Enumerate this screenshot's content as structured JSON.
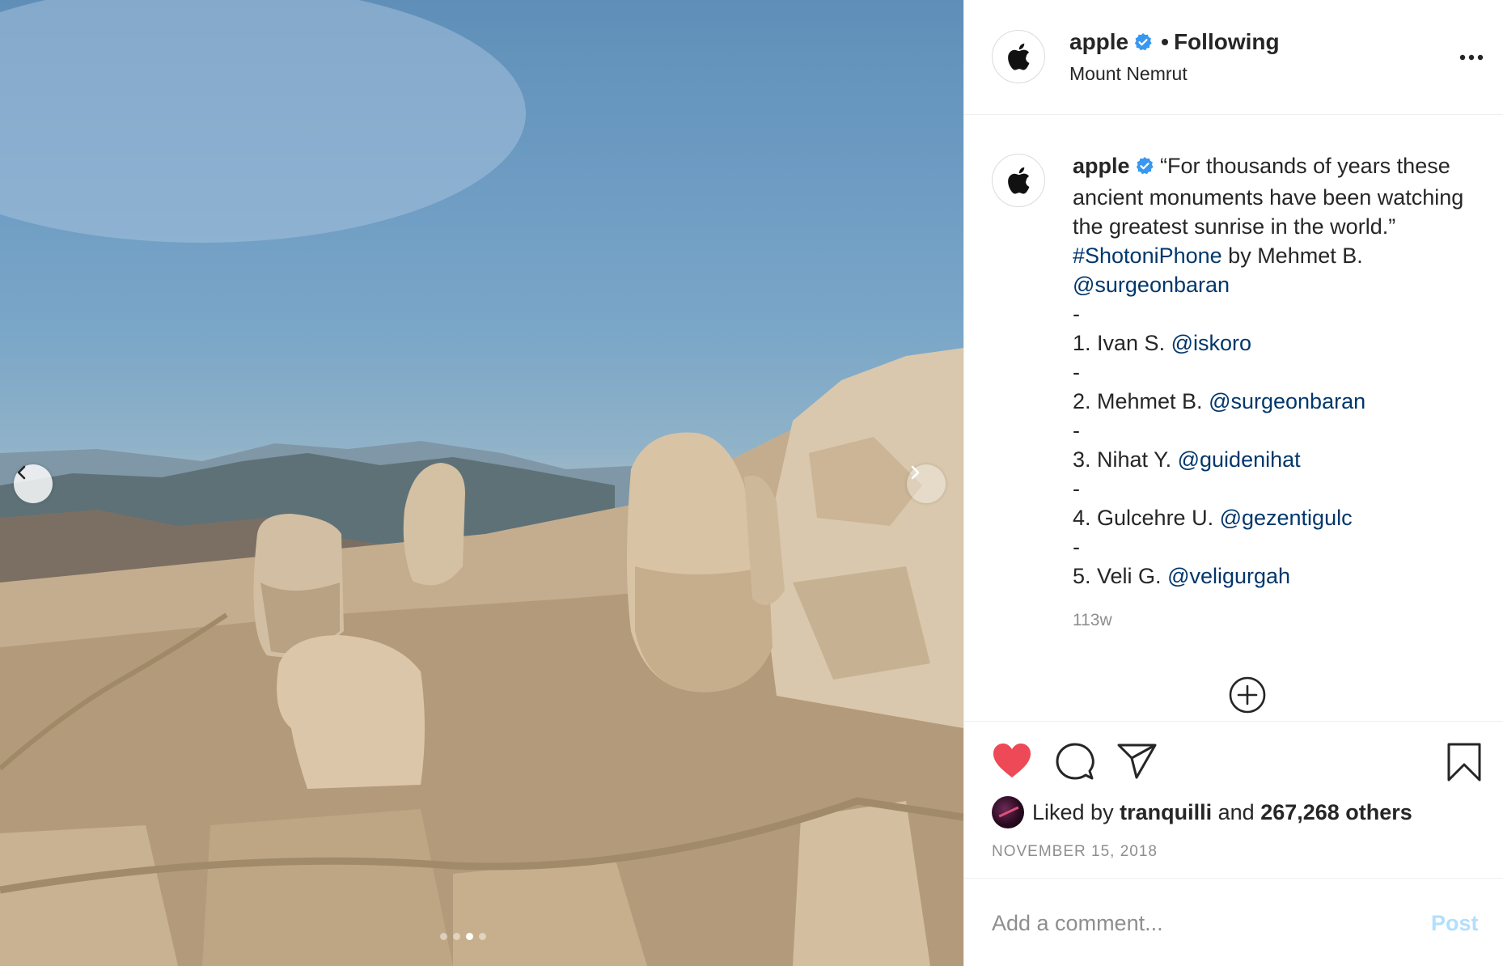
{
  "photo": {
    "alt_icon": "photo-of-stone-statue-heads",
    "carousel_dots": 4,
    "active_dot": 2
  },
  "header": {
    "username": "apple",
    "separator": "•",
    "follow_status": "Following",
    "location": "Mount Nemrut"
  },
  "caption": {
    "username": "apple",
    "segments": [
      {
        "text": "“For thousands of years these ancient monuments have been watching the greatest sunrise in the world.” ",
        "link": false
      },
      {
        "text": "#ShotoniPhone",
        "link": true
      },
      {
        "text": " by Mehmet B. ",
        "link": false
      },
      {
        "text": "@surgeonbaran",
        "link": true
      },
      {
        "text": "\n-\n1. Ivan S. ",
        "link": false
      },
      {
        "text": "@iskoro",
        "link": true
      },
      {
        "text": "\n-\n2. Mehmet B. ",
        "link": false
      },
      {
        "text": "@surgeonbaran",
        "link": true
      },
      {
        "text": "\n-\n3. Nihat Y. ",
        "link": false
      },
      {
        "text": "@guidenihat",
        "link": true
      },
      {
        "text": "\n-\n4. Gulcehre U. ",
        "link": false
      },
      {
        "text": "@gezentigulc",
        "link": true
      },
      {
        "text": "\n-\n5. Veli G. ",
        "link": false
      },
      {
        "text": "@veligurgah",
        "link": true
      }
    ],
    "age": "113w"
  },
  "actions": {
    "liked_prefix": "Liked by ",
    "liked_by": "tranquilli",
    "liked_and": " and ",
    "liked_count": "267,268 others",
    "date": "NOVEMBER 15, 2018"
  },
  "comment": {
    "placeholder": "Add a comment...",
    "post_label": "Post"
  },
  "colors": {
    "heart": "#ed4956",
    "link": "#00376b",
    "verified": "#3897f0",
    "post_disabled": "#b2dffc"
  }
}
